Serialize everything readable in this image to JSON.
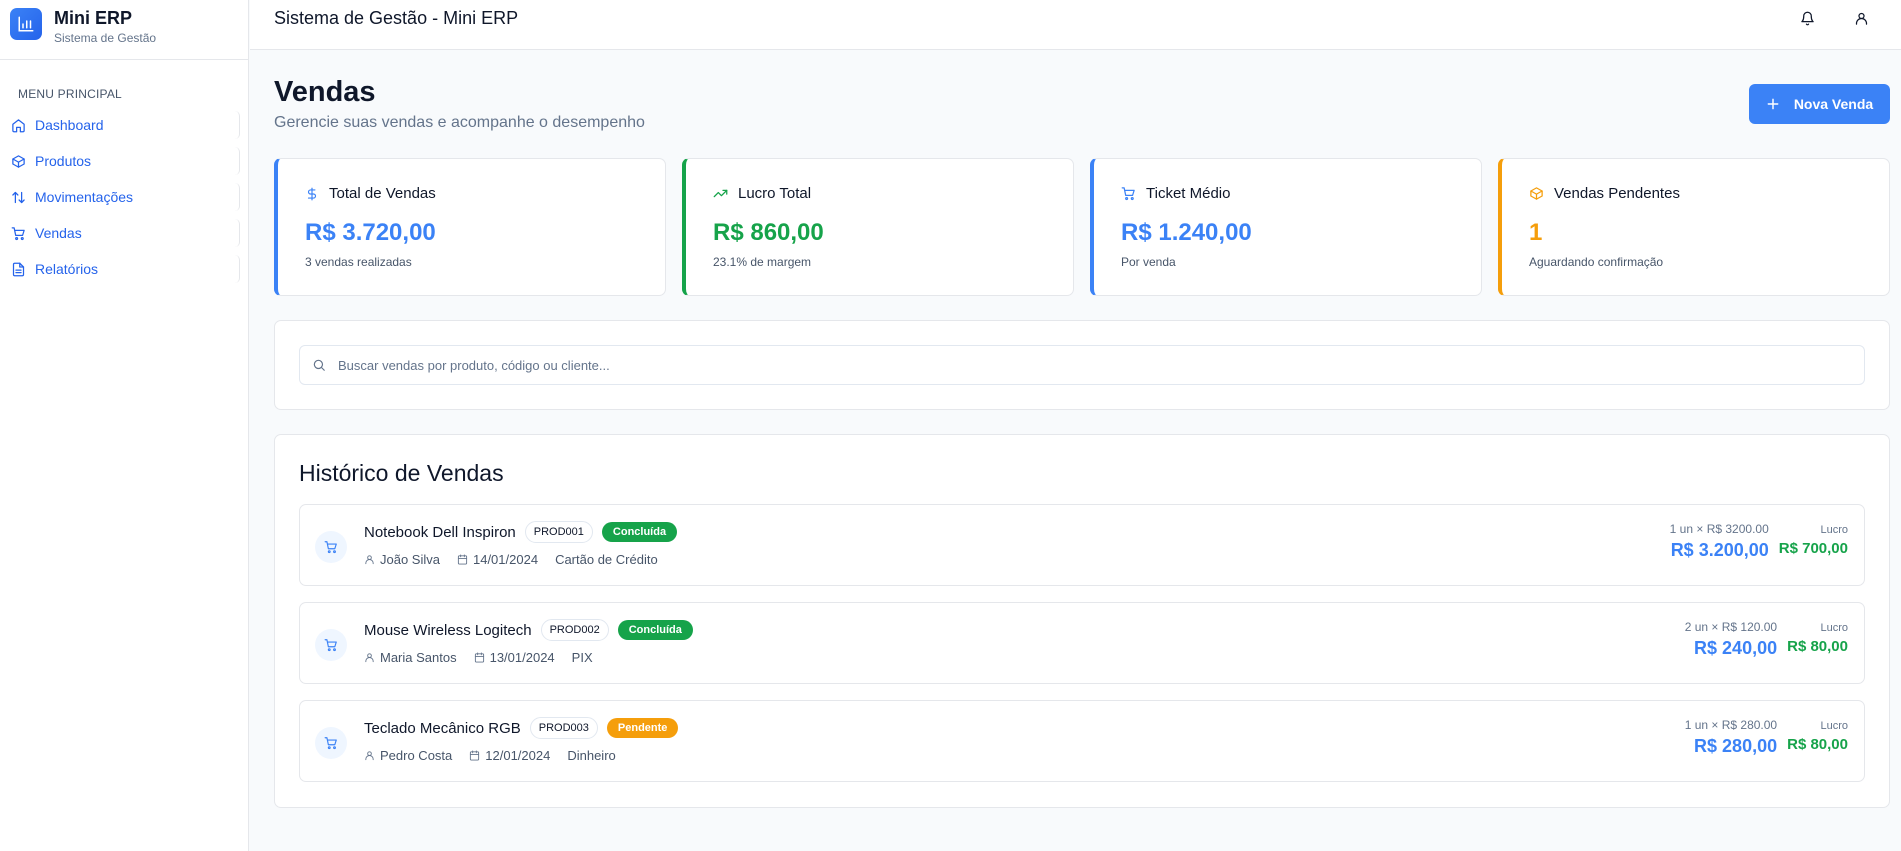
{
  "brand": {
    "title": "Mini ERP",
    "subtitle": "Sistema de Gestão"
  },
  "sidebar": {
    "menu_label": "MENU PRINCIPAL",
    "items": [
      {
        "label": "Dashboard",
        "icon": "home-icon"
      },
      {
        "label": "Produtos",
        "icon": "package-icon"
      },
      {
        "label": "Movimentações",
        "icon": "arrows-up-down-icon"
      },
      {
        "label": "Vendas",
        "icon": "cart-icon"
      },
      {
        "label": "Relatórios",
        "icon": "file-text-icon"
      }
    ]
  },
  "header": {
    "title": "Sistema de Gestão - Mini ERP",
    "icons": [
      "bell-icon",
      "user-icon"
    ]
  },
  "page": {
    "title": "Vendas",
    "subtitle": "Gerencie suas vendas e acompanhe o desempenho",
    "new_button": "Nova Venda"
  },
  "cards": [
    {
      "title": "Total de Vendas",
      "value": "R$ 3.720,00",
      "note": "3 vendas realizadas",
      "icon": "dollar-icon",
      "color": "#3b82f6"
    },
    {
      "title": "Lucro Total",
      "value": "R$ 860,00",
      "note": "23.1% de margem",
      "icon": "trending-up-icon",
      "color": "#16a34a"
    },
    {
      "title": "Ticket Médio",
      "value": "R$ 1.240,00",
      "note": "Por venda",
      "icon": "cart-icon",
      "color": "#3b82f6"
    },
    {
      "title": "Vendas Pendentes",
      "value": "1",
      "note": "Aguardando confirmação",
      "icon": "package-icon",
      "color": "#f59e0b"
    }
  ],
  "search": {
    "placeholder": "Buscar vendas por produto, código ou cliente..."
  },
  "history": {
    "title": "Histórico de Vendas",
    "profit_label": "Lucro",
    "sales": [
      {
        "product": "Notebook Dell Inspiron",
        "code": "PROD001",
        "status": "Concluída",
        "customer": "João Silva",
        "date": "14/01/2024",
        "payment": "Cartão de Crédito",
        "qty": "1 un × R$ 3200.00",
        "total": "R$ 3.200,00",
        "profit": "R$ 700,00"
      },
      {
        "product": "Mouse Wireless Logitech",
        "code": "PROD002",
        "status": "Concluída",
        "customer": "Maria Santos",
        "date": "13/01/2024",
        "payment": "PIX",
        "qty": "2 un × R$ 120.00",
        "total": "R$ 240,00",
        "profit": "R$ 80,00"
      },
      {
        "product": "Teclado Mecânico RGB",
        "code": "PROD003",
        "status": "Pendente",
        "customer": "Pedro Costa",
        "date": "12/01/2024",
        "payment": "Dinheiro",
        "qty": "1 un × R$ 280.00",
        "total": "R$ 280,00",
        "profit": "R$ 80,00"
      }
    ]
  },
  "colors": {
    "primary": "#3b82f6",
    "success": "#16a34a",
    "warning": "#f59e0b"
  }
}
